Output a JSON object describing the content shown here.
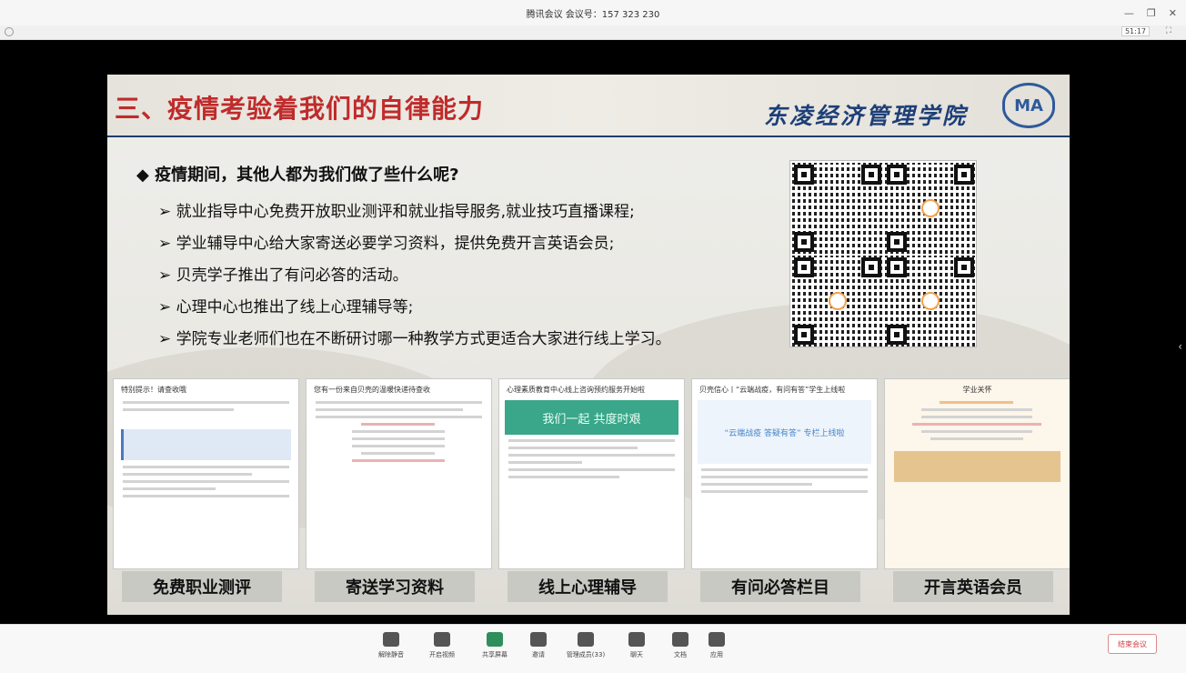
{
  "window": {
    "title": "腾讯会议 会议号：157 323 230",
    "timer": "51:17"
  },
  "slide": {
    "title": "三、疫情考验着我们的自律能力",
    "school": "东凌经济管理学院",
    "logo": "MA",
    "question": "疫情期间，其他人都为我们做了些什么呢?",
    "bullets": [
      "就业指导中心免费开放职业测评和就业指导服务,就业技巧直播课程;",
      "学业辅导中心给大家寄送必要学习资料，提供免费开言英语会员;",
      "贝壳学子推出了有问必答的活动。",
      "心理中心也推出了线上心理辅导等;",
      "学院专业老师们也在不断研讨哪一种教学方式更适合大家进行线上学习。"
    ],
    "cards": [
      {
        "caption": "免费职业测评",
        "header": "特别提示！请查收哦"
      },
      {
        "caption": "寄送学习资料",
        "header": "您有一份来自贝壳的温暖快递待查收"
      },
      {
        "caption": "线上心理辅导",
        "header": "心理素质教育中心线上咨询预约服务开始啦",
        "banner": "我们一起 共度时艰"
      },
      {
        "caption": "有问必答栏目",
        "header": "贝壳信心丨“云端战疫，有问有答”学生上线啦",
        "banner": "“云端战疫 答疑有答” 专栏上线啦"
      },
      {
        "caption": "开言英语会员",
        "header": "学业关怀"
      }
    ]
  },
  "toolbar": {
    "items": [
      {
        "label": "解除静音",
        "icon": "mic-muted-icon"
      },
      {
        "label": "开启视频",
        "icon": "camera-off-icon"
      },
      {
        "label": "共享屏幕",
        "icon": "share-screen-icon"
      },
      {
        "label": "邀请",
        "icon": "invite-icon"
      },
      {
        "label": "管理成员(33)",
        "icon": "members-icon"
      },
      {
        "label": "聊天",
        "icon": "chat-icon"
      },
      {
        "label": "文档",
        "icon": "document-icon"
      },
      {
        "label": "应用",
        "icon": "apps-icon"
      }
    ],
    "end_label": "结束会议"
  },
  "colors": {
    "title_red": "#c02b2b",
    "school_blue": "#1d3f78",
    "end_red": "#d23c3c"
  }
}
